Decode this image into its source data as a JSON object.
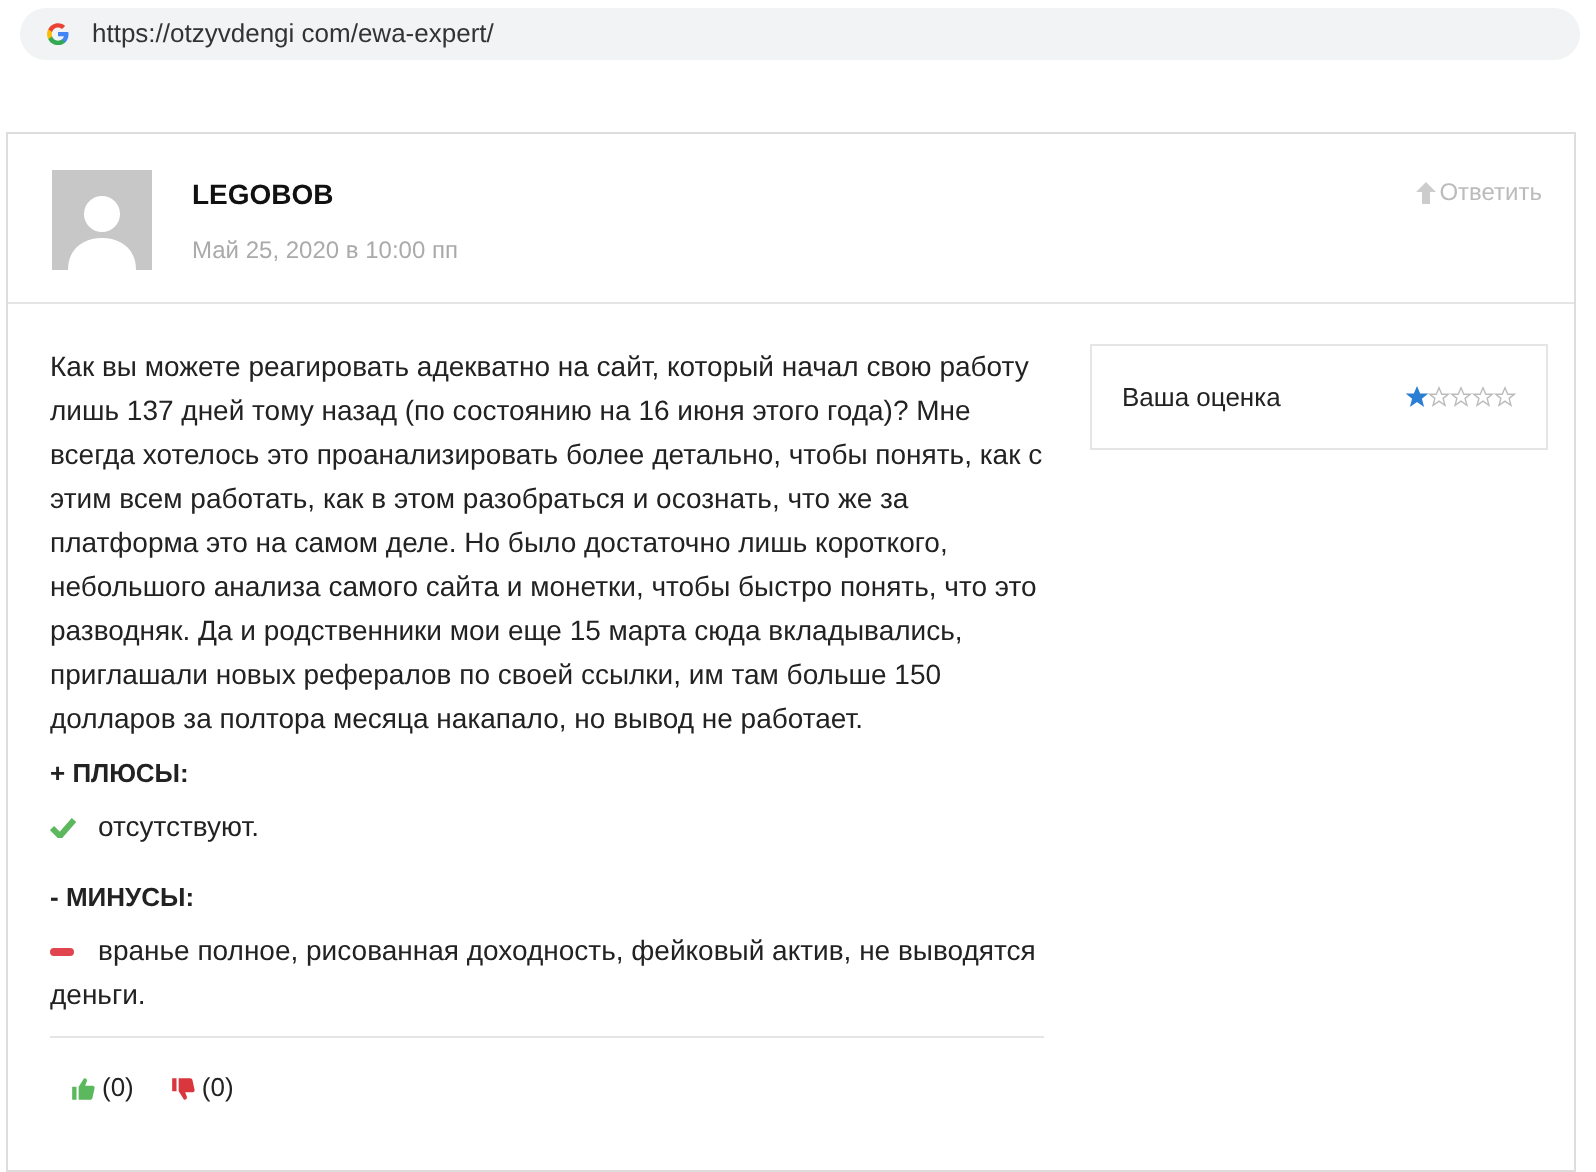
{
  "address_bar": {
    "url": "https://otzyvdengi com/ewa-expert/"
  },
  "review": {
    "author": "LEGOBOB",
    "date": "Май 25, 2020 в 10:00 пп",
    "reply": "Ответить",
    "text": "Как вы можете реагировать адекватно на сайт, который начал свою работу лишь 137 дней тому назад (по состоянию на 16 июня этого года)? Мне всегда хотелось это проанализировать более детально, чтобы понять, как с этим всем работать, как в этом разобраться и осознать, что же за платформа это на самом деле. Но было достаточно лишь короткого, небольшого анализа самого сайта и монетки, чтобы быстро понять, что это разводняк. Да и родственники мои еще 15 марта сюда вкладывались, приглашали новых рефералов по своей ссылки, им там больше 150 долларов за полтора месяца накапало, но вывод не работает.",
    "sections": [
      {
        "kind": "pros",
        "heading": "+ ПЛЮСЫ:",
        "text": "отсутствуют."
      },
      {
        "kind": "cons",
        "heading": "- МИНУСЫ:",
        "text": "вранье полное, рисованная доходность, фейковый актив, не выводятся деньги."
      }
    ],
    "rating": {
      "label": "Ваша оценка",
      "stars": 1
    },
    "votes": {
      "up": "(0)",
      "down": "(0)"
    }
  }
}
